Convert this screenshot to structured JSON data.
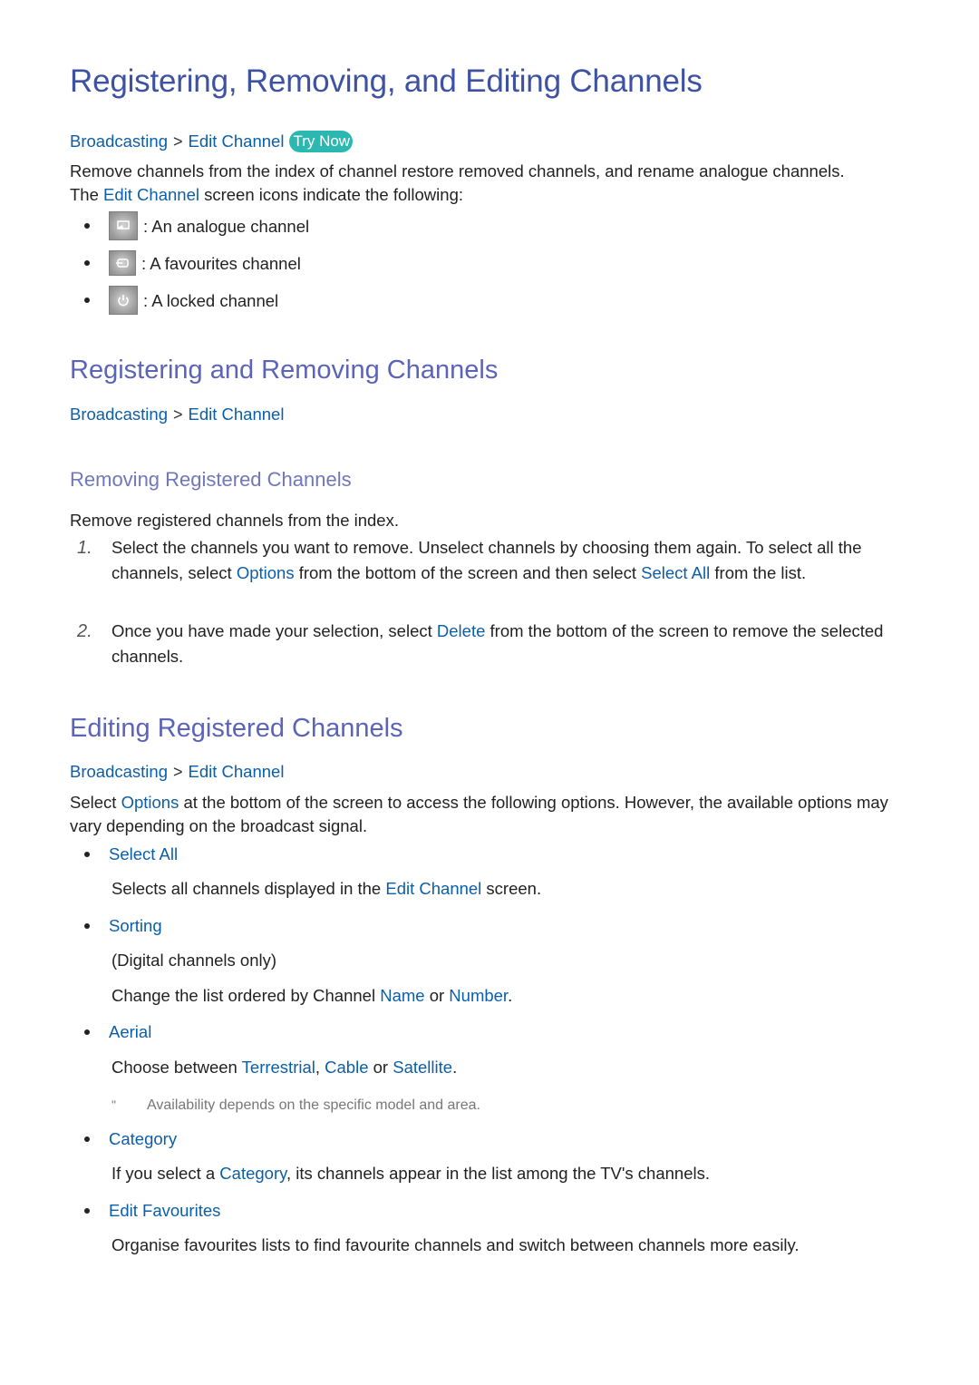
{
  "title": "Registering, Removing, and Editing Channels",
  "intro": {
    "breadcrumb": {
      "root": "Broadcasting",
      "separator": ">",
      "leaf": "Edit Channel",
      "try_now": "Try Now"
    },
    "line1": "Remove channels from the index of channel restore removed channels, and rename analogue channels.",
    "line2_pre": "The ",
    "line2_link": "Edit Channel",
    "line2_post": " screen icons indicate the following:",
    "icons": [
      {
        "icon": "analogue-channel-icon",
        "label": ": An analogue channel"
      },
      {
        "icon": "favourites-channel-icon",
        "label": ": A favourites channel"
      },
      {
        "icon": "locked-channel-icon",
        "label": ": A locked channel"
      }
    ]
  },
  "section_register": {
    "heading": "Registering and Removing Channels",
    "breadcrumb": {
      "root": "Broadcasting",
      "separator": ">",
      "leaf": "Edit Channel"
    },
    "subheading": "Removing Registered Channels",
    "intro": "Remove registered channels from the index.",
    "steps": [
      {
        "num": "1.",
        "t1": "Select the channels you want to remove. Unselect channels by choosing them again. To select all the channels, select ",
        "l1": "Options",
        "t2": " from the bottom of the screen and then select ",
        "l2": "Select All",
        "t3": " from the list."
      },
      {
        "num": "2.",
        "t1": "Once you have made your selection, select ",
        "l1": "Delete",
        "t2": " from the bottom of the screen to remove the selected channels."
      }
    ]
  },
  "section_edit": {
    "heading": "Editing Registered Channels",
    "breadcrumb": {
      "root": "Broadcasting",
      "separator": ">",
      "leaf": "Edit Channel"
    },
    "intro_pre": "Select ",
    "intro_link": "Options",
    "intro_post": " at the bottom of the screen to access the following options. However, the available options may vary depending on the broadcast signal.",
    "options": {
      "select_all": {
        "title": "Select All",
        "desc_pre": "Selects all channels displayed in the ",
        "desc_link": "Edit Channel",
        "desc_post": " screen."
      },
      "sorting": {
        "title": "Sorting",
        "desc1": "(Digital channels only)",
        "desc2_pre": "Change the list ordered by Channel ",
        "desc2_l1": "Name",
        "desc2_mid": " or ",
        "desc2_l2": "Number",
        "desc2_post": "."
      },
      "aerial": {
        "title": "Aerial",
        "desc_pre": "Choose between ",
        "l1": "Terrestrial",
        "sep1": ", ",
        "l2": "Cable",
        "sep2": " or ",
        "l3": "Satellite",
        "post": ".",
        "note_mark": "\"",
        "note": "Availability depends on the specific model and area."
      },
      "category": {
        "title": "Category",
        "desc_pre": "If you select a ",
        "desc_link": "Category",
        "desc_post": ", its channels appear in the list among the TV's channels."
      },
      "edit_favourites": {
        "title": "Edit Favourites",
        "desc": "Organise favourites lists to find favourite channels and switch between channels more easily."
      }
    }
  },
  "colors": {
    "title": "#3e52a3",
    "heading": "#5b64b8",
    "link": "#0d5ea8",
    "try_now_bg": "#2bb8b0"
  }
}
